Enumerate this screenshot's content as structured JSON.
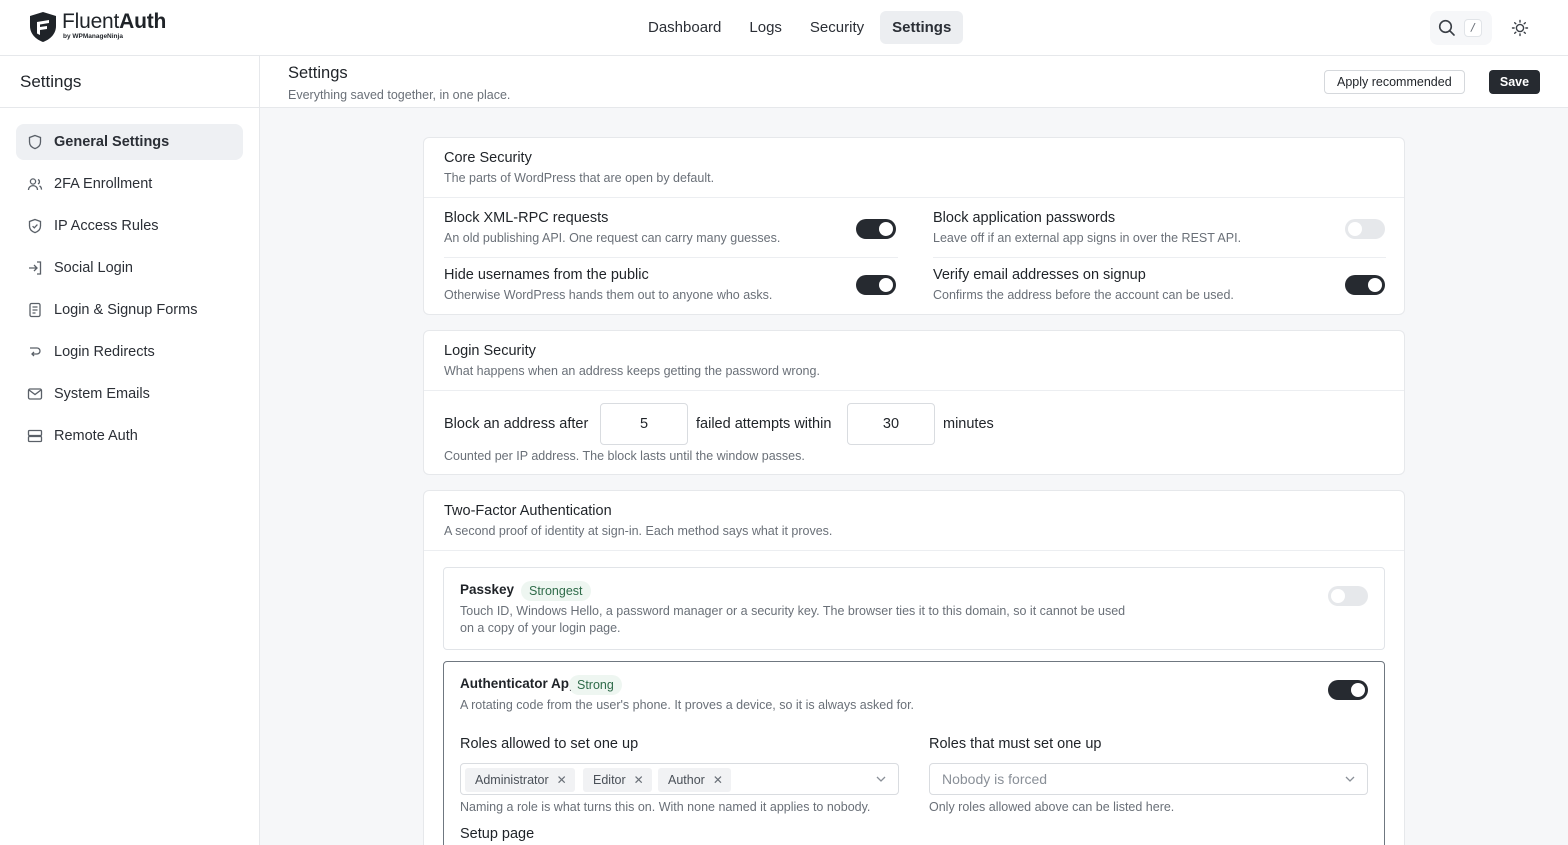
{
  "brand": {
    "name_light": "Fluent",
    "name_bold": "Auth",
    "byline": "by WPManageNinja"
  },
  "nav": {
    "items": [
      "Dashboard",
      "Logs",
      "Security",
      "Settings"
    ],
    "active": "Settings"
  },
  "search": {
    "shortcut": "/"
  },
  "sidebar": {
    "title": "Settings",
    "items": [
      {
        "label": "General Settings",
        "icon": "shield-icon",
        "active": true
      },
      {
        "label": "2FA Enrollment",
        "icon": "users-icon"
      },
      {
        "label": "IP Access Rules",
        "icon": "shield-icon"
      },
      {
        "label": "Social Login",
        "icon": "login-icon"
      },
      {
        "label": "Login & Signup Forms",
        "icon": "form-icon"
      },
      {
        "label": "Login Redirects",
        "icon": "redirect-icon"
      },
      {
        "label": "System Emails",
        "icon": "mail-icon"
      },
      {
        "label": "Remote Auth",
        "icon": "server-icon"
      }
    ]
  },
  "page": {
    "title": "Settings",
    "subtitle": "Everything saved together, in one place.",
    "apply_label": "Apply recommended",
    "save_label": "Save"
  },
  "core": {
    "title": "Core Security",
    "subtitle": "The parts of WordPress that are open by default.",
    "settings": [
      {
        "title": "Block XML-RPC requests",
        "desc": "An old publishing API. One request can carry many guesses.",
        "on": true
      },
      {
        "title": "Block application passwords",
        "desc": "Leave off if an external app signs in over the REST API.",
        "on": false
      },
      {
        "title": "Hide usernames from the public",
        "desc": "Otherwise WordPress hands them out to anyone who asks.",
        "on": true
      },
      {
        "title": "Verify email addresses on signup",
        "desc": "Confirms the address before the account can be used.",
        "on": true
      }
    ]
  },
  "login": {
    "title": "Login Security",
    "subtitle": "What happens when an address keeps getting the password wrong.",
    "label_before": "Block an address after",
    "attempts": "5",
    "label_middle": "failed attempts within",
    "minutes": "30",
    "label_after": "minutes",
    "hint": "Counted per IP address. The block lasts until the window passes."
  },
  "twofa": {
    "title": "Two-Factor Authentication",
    "subtitle": "A second proof of identity at sign-in. Each method says what it proves.",
    "passkey": {
      "title": "Passkey",
      "badge": "Strongest",
      "desc_line1": "Touch ID, Windows Hello, a password manager or a security key. The browser ties it to this domain, so it cannot be used",
      "desc_line2": "on a copy of your login page.",
      "on": false
    },
    "app": {
      "title": "Authenticator App",
      "badge": "Strong",
      "desc": "A rotating code from the user's phone. It proves a device, so it is always asked for.",
      "on": true,
      "allowed_label": "Roles allowed to set one up",
      "allowed_roles": [
        "Administrator",
        "Editor",
        "Author"
      ],
      "allowed_hint": "Naming a role is what turns this on. With none named it applies to nobody.",
      "forced_label": "Roles that must set one up",
      "forced_placeholder": "Nobody is forced",
      "forced_hint": "Only roles allowed above can be listed here.",
      "setup_label": "Setup page"
    }
  }
}
